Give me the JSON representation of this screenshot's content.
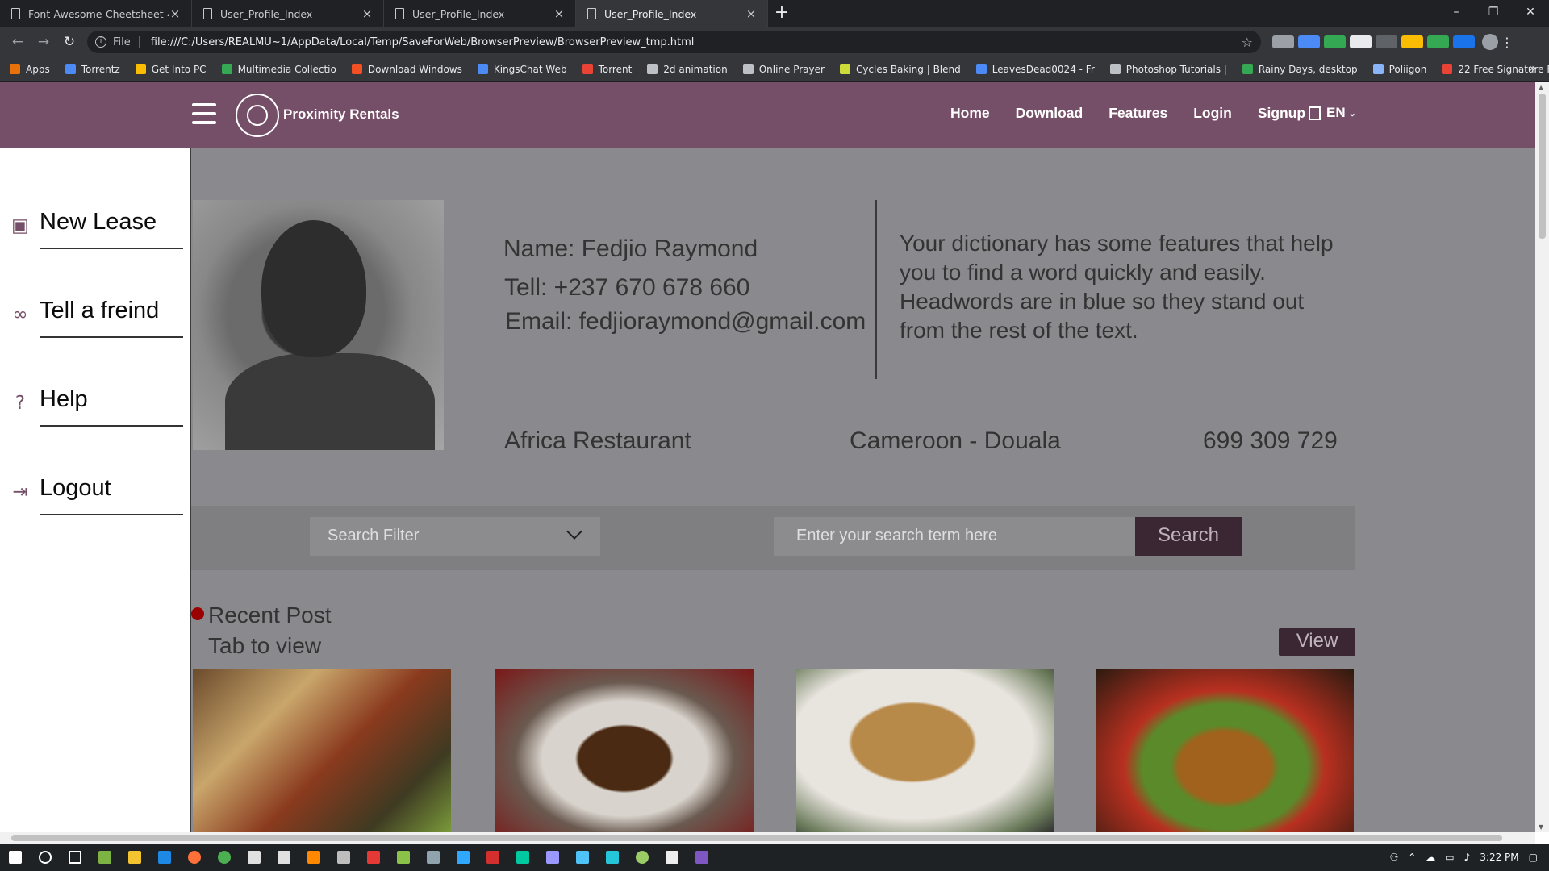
{
  "browser": {
    "tabs": [
      {
        "title": "Font-Awesome-Cheetsheet-4.5.0"
      },
      {
        "title": "User_Profile_Index"
      },
      {
        "title": "User_Profile_Index"
      },
      {
        "title": "User_Profile_Index"
      }
    ],
    "active_tab_index": 3,
    "new_tab": "+",
    "window_controls": {
      "minimize": "–",
      "maximize": "❐",
      "close": "✕"
    },
    "address": {
      "scheme": "File",
      "url": "file:///C:/Users/REALMU~1/AppData/Local/Temp/SaveForWeb/BrowserPreview/BrowserPreview_tmp.html"
    },
    "nav": {
      "back": "←",
      "forward": "→",
      "reload": "↻"
    },
    "bookmarks": [
      {
        "label": "Apps",
        "color": "#e8710a"
      },
      {
        "label": "Torrentz",
        "color": "#4c8bf5"
      },
      {
        "label": "Get Into PC",
        "color": "#fbbc04"
      },
      {
        "label": "Multimedia Collectio",
        "color": "#34a853"
      },
      {
        "label": "Download Windows",
        "color": "#f25022"
      },
      {
        "label": "KingsChat Web",
        "color": "#4c8bf5"
      },
      {
        "label": "Torrent",
        "color": "#ea4335"
      },
      {
        "label": "2d animation",
        "color": "#bdc1c6"
      },
      {
        "label": "Online Prayer",
        "color": "#bdc1c6"
      },
      {
        "label": "Cycles Baking | Blend",
        "color": "#cddc39"
      },
      {
        "label": "LeavesDead0024 - Fr",
        "color": "#4c8bf5"
      },
      {
        "label": "Photoshop Tutorials |",
        "color": "#bdc1c6"
      },
      {
        "label": "Rainy Days, desktop",
        "color": "#34a853"
      },
      {
        "label": "Poliigon",
        "color": "#8ab4f8"
      },
      {
        "label": "22 Free Signature Fo",
        "color": "#ea4335"
      }
    ],
    "bookmarks_more": "»"
  },
  "site": {
    "brand": "Proximity Rentals",
    "nav": [
      "Home",
      "Download",
      "Features",
      "Login",
      "Signup"
    ],
    "language": "EN",
    "accent_color": "#754e67"
  },
  "side_menu": {
    "items": [
      {
        "label": "New Lease",
        "icon": "image-icon"
      },
      {
        "label": "Tell a freind",
        "icon": "link-icon"
      },
      {
        "label": "Help",
        "icon": "question-circle-icon"
      },
      {
        "label": "Logout",
        "icon": "sign-out-icon"
      }
    ]
  },
  "profile": {
    "name": "Name: Fedjio Raymond",
    "tell": "Tell: +237 670 678 660",
    "email": "Email: fedjioraymond@gmail.com",
    "bio": "Your dictionary has some features that help you to find a word quickly and easily. Headwords are in blue so they stand out from the rest of the text.",
    "business": "Africa Restaurant",
    "location": "Cameroon - Douala",
    "phone": "699 309 729"
  },
  "search": {
    "filter_label": "Search Filter",
    "placeholder": "Enter your search term here",
    "button": "Search"
  },
  "recent": {
    "title": "Recent Post",
    "subtitle": "Tab to view",
    "view_button": "View"
  },
  "taskbar": {
    "time": "3:22 PM"
  }
}
